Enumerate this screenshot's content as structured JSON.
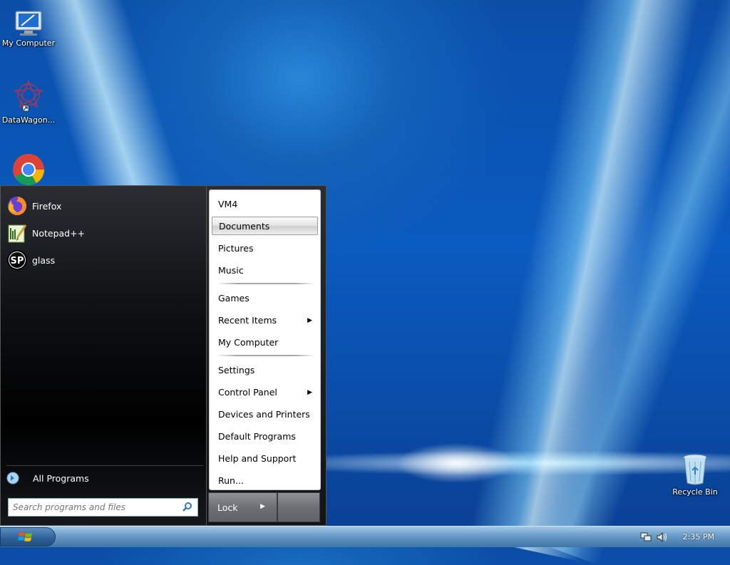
{
  "desktop": {
    "icons": [
      {
        "label": "My Computer"
      },
      {
        "label": "DataWagon..."
      },
      {
        "label": "Recycle Bin"
      }
    ]
  },
  "start_menu": {
    "pinned": [
      {
        "label": "Firefox",
        "icon": "firefox-icon"
      },
      {
        "label": "Notepad++",
        "icon": "notepad-plus-plus-icon"
      },
      {
        "label": "glass",
        "icon": "sp-icon"
      }
    ],
    "all_programs": "All Programs",
    "search_placeholder": "Search programs and files",
    "places": {
      "user": "VM4",
      "documents": "Documents",
      "pictures": "Pictures",
      "music": "Music",
      "games": "Games",
      "recent_items": "Recent Items",
      "my_computer": "My Computer",
      "settings": "Settings",
      "control_panel": "Control Panel",
      "devices_printers": "Devices and Printers",
      "default_programs": "Default Programs",
      "help_support": "Help and Support",
      "run": "Run..."
    },
    "lock": "Lock"
  },
  "taskbar": {
    "clock": "2:35 PM"
  }
}
